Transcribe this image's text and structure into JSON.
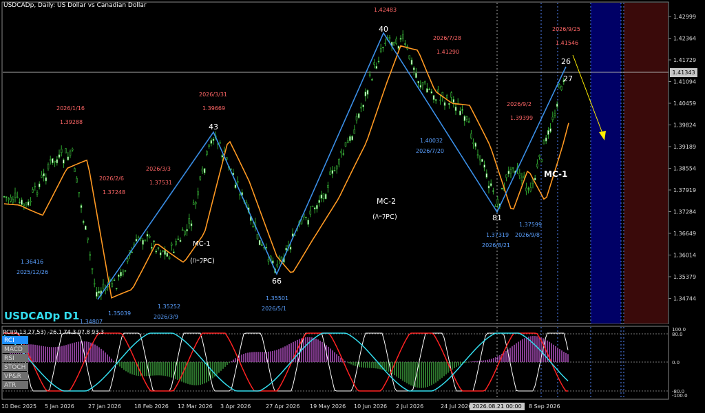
{
  "chart": {
    "title": "USDCADp, Daily:  US Dollar vs Canadian Dollar",
    "symbol_label": "USDCADp D1",
    "current_price": "1.41343",
    "indicator_title": "RCI(9,13,27,53) -26.1 74.3 97.8 93.3",
    "indicator_buttons": [
      "RCI",
      "MACD",
      "RSI",
      "STOCH",
      "VP&R",
      "ATR"
    ],
    "active_indicator": "RCI",
    "highlight_date": "2026.08.21 00:00",
    "price_axis": [
      "1.42999",
      "1.42364",
      "1.41729",
      "1.41094",
      "1.40459",
      "1.39824",
      "1.39189",
      "1.38554",
      "1.37919",
      "1.37284",
      "1.36649",
      "1.36014",
      "1.35379",
      "1.34744"
    ],
    "indicator_axis": [
      "100.0",
      "80.0",
      "0.0",
      "-80.0",
      "-100.0"
    ],
    "date_axis": [
      "10 Dec 2025",
      "5 Jan 2026",
      "27 Jan 2026",
      "18 Feb 2026",
      "12 Mar 2026",
      "3 Apr 2026",
      "27 Apr 2026",
      "19 May 2026",
      "10 Jun 2026",
      "2 Jul 2026",
      "24 Jul 2026",
      "8 Sep 2026"
    ],
    "pivot_counts": [
      "43",
      "40",
      "66",
      "81",
      "26",
      "27"
    ],
    "wave_labels": [
      "MC-1",
      "(ﾊｰﾌPC)",
      "MC-2",
      "(ﾊｰﾌPC)",
      "MC-1"
    ],
    "high_annotations": [
      {
        "date": "2026/1/16",
        "price": "1.39288"
      },
      {
        "date": "2026/2/6",
        "price": "1.37248"
      },
      {
        "date": "2026/3/3",
        "price": "1.37531"
      },
      {
        "date": "2026/3/31",
        "price": "1.39669"
      },
      {
        "date": "",
        "price": "1.42483"
      },
      {
        "date": "2026/7/28",
        "price": "1.41290"
      },
      {
        "date": "2026/9/2",
        "price": "1.39399"
      },
      {
        "date": "2026/9/25",
        "price": "1.41546"
      }
    ],
    "low_annotations": [
      {
        "date": "2025/12/26",
        "price": "1.36416"
      },
      {
        "date": "",
        "price": "1.34807"
      },
      {
        "date": "",
        "price": "1.35039"
      },
      {
        "date": "2026/3/9",
        "price": "1.35252"
      },
      {
        "date": "2026/5/1",
        "price": "1.35501"
      },
      {
        "date": "2026/7/20",
        "price": "1.40032"
      },
      {
        "date": "2026/8/21",
        "price": "1.37319"
      },
      {
        "date": "2026/9/8",
        "price": "1.37599"
      }
    ],
    "colors": {
      "candle": "#2faa2f",
      "ma": "#ff9922",
      "zigzag": "#3a8ee6",
      "high_annot": "#ff6666",
      "low_annot": "#5aa0ff",
      "future_zone_1": "#000066",
      "future_zone_2": "#3a0a0a",
      "rci_short": "#ffffff",
      "rci_mid": "#ff2222",
      "rci_long": "#33ddee"
    }
  }
}
